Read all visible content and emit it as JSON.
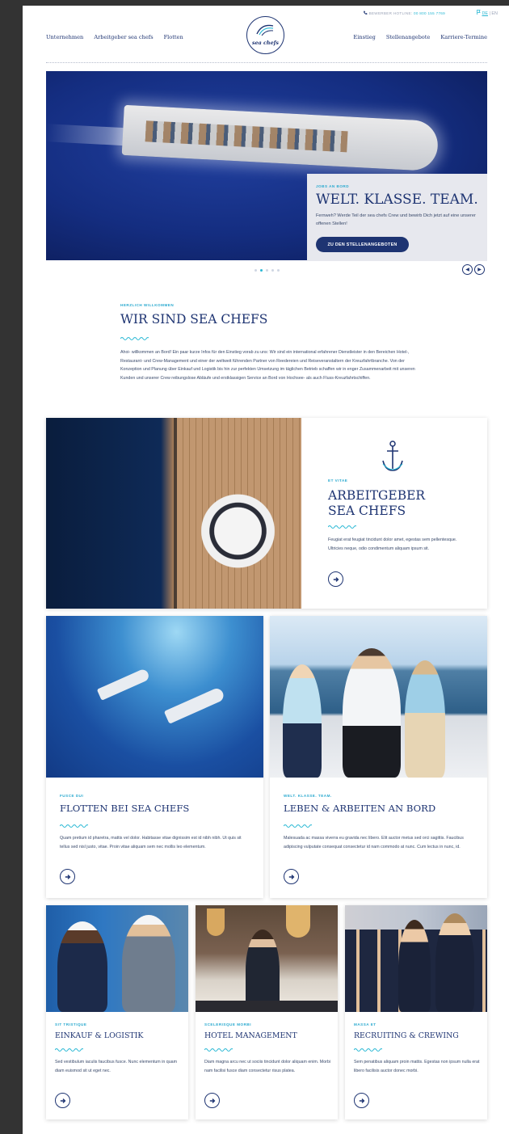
{
  "header": {
    "nav_left": [
      "Unternehmen",
      "Arbeitgeber sea chefs",
      "Flotten"
    ],
    "nav_right": [
      "Einstieg",
      "Stellenangebote",
      "Karriere-Termine"
    ],
    "hotline_label": "BEWERBER HOTLINE:",
    "hotline_number": "00 800 155 7769",
    "lang_de": "DE",
    "lang_en": "EN",
    "logo_text": "sea chefs"
  },
  "hero": {
    "kicker": "JOBS AN BORD",
    "title": "WELT. KLASSE. TEAM.",
    "text": "Fernweh? Werde Teil der sea chefs Crew und bewirb Dich jetzt auf eine unserer offenen Stellen!",
    "button": "ZU DEN STELLENANGEBOTEN",
    "slide_count": 5,
    "active_slide": 2
  },
  "welcome": {
    "kicker": "HERZLICH WILLKOMMEN",
    "title": "WIR SIND SEA CHEFS",
    "text": "Ahoi- willkommen an Bord! Ein paar kurze Infos für den Einstieg vorab zu uns: Wir sind ein international erfahrener Dienstleister in den Bereichen Hotel-, Restaurant- und Crew-Management und einer der weltweit führenden Partner von Reedereien und Reiseveranstaltern der Kreuzfahrtbranche. Von der Konzeption und Planung über Einkauf und Logistik bis hin zur perfekten Umsetzung im täglichen Betrieb schaffen wir in enger Zusammenarbeit mit unseren Kunden und unserer Crew reibungslose Abläufe und erstklassigen Service an Bord von Hochsee- als auch Fluss-Kreuzfahrtschiffen."
  },
  "employer": {
    "kicker": "ET VITAE",
    "title_line1": "ARBEITGEBER",
    "title_line2": "SEA CHEFS",
    "text": "Feugiat erat feugiat tincidunt dolor amet, egestas sem pellentesque. Ultricies neque, odio condimentum aliquam ipsum sit."
  },
  "fleet": {
    "kicker": "FUSCE DUI",
    "title": "FLOTTEN BEI SEA CHEFS",
    "text": "Quam pretium id pharetra, mattis vel dolor. Habitasse vitae dignissim est id nibh nibh. Ut quis sit tellus sed nisl justo, vitae. Proin vitae aliquam sem nec mollis leo elementum."
  },
  "life": {
    "kicker": "WELT. KLASSE. TEAM.",
    "title": "LEBEN & ARBEITEN AN BORD",
    "text": "Malesuada ac massa viverra eu gravida nec libero. Elit auctor metus sed orci sagittis. Faucibus adipiscing vulputate consequat consectetur id nam commodo at nunc. Cum lectus in nunc, id."
  },
  "small_cards": [
    {
      "kicker": "SIT TRISTIQUE",
      "title": "EINKAUF & LOGISTIK",
      "text": "Sed vestibulum iaculis faucibus fusce. Nunc elementum in quam diam euismod sit ut eget nec."
    },
    {
      "kicker": "SCELERISQUE MORBI",
      "title": "HOTEL MANAGEMENT",
      "text": "Diam magna arcu nec ut sociis tincidunt dolor aliquam enim. Morbi nam facilisi fusce diam consectetur risus platea."
    },
    {
      "kicker": "MASSA ET",
      "title": "RECRUITING & CREWING",
      "text": "Sem penatibus aliquam proin mattis. Egestas non ipsum nulla erat libero facilisis auctor donec morbi."
    }
  ],
  "colors": {
    "navy": "#1e3472",
    "accent": "#29b8d4",
    "text": "#3a4a6b"
  },
  "icons": [
    "phone-icon",
    "flag-icon",
    "anchor-icon",
    "arrow-right-icon",
    "arrow-left-icon",
    "wave-divider-icon"
  ]
}
